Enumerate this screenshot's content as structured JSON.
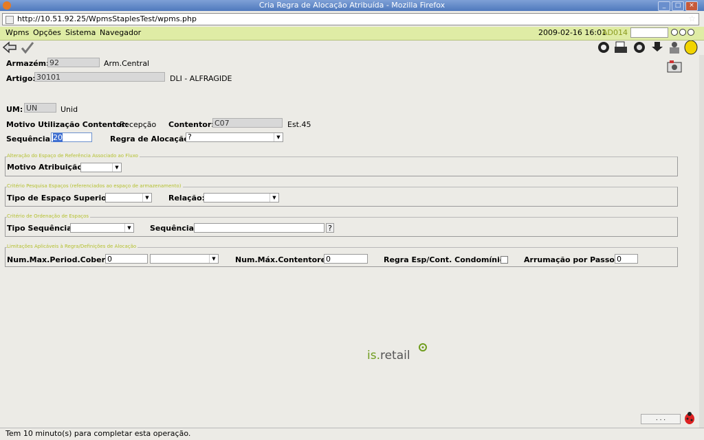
{
  "window": {
    "title": "Cria Regra de Alocação Atribuída - Mozilla Firefox",
    "buttons": [
      "_",
      "□",
      "×"
    ]
  },
  "url": "http://10.51.92.25/WpmsStaplesTest/wpms.php",
  "menu": {
    "items": [
      "Wpms",
      "Opções",
      "Sistema",
      "Navegador"
    ],
    "datetime": "2009-02-16 16:01",
    "user": "AD014"
  },
  "form": {
    "armazem_label": "Armazém:",
    "armazem_value": "92",
    "armazem_desc": "Arm.Central",
    "artigo_label": "Artigo:",
    "artigo_value": "30101",
    "artigo_desc": "DLI - ALFRAGIDE",
    "um_label": "UM:",
    "um_value": "UN",
    "um_desc": "Unid",
    "motivo_label": "Motivo Utilização Contentor:",
    "motivo_value": "Recepção",
    "contentor_label": "Contentor:",
    "contentor_value": "C07",
    "contentor_desc": "Est.45",
    "sequencia_label": "Sequência:",
    "sequencia_value": "20",
    "regra_label": "Regra de Alocação:",
    "regra_value": "?"
  },
  "sections": {
    "s1": {
      "legend": "Alteração do Espaço de Referência Associado ao Fluxo",
      "motivo_label": "Motivo Atribuição:",
      "motivo_value": ""
    },
    "s2": {
      "legend": "Critério Pesquisa Espaços (referenciados ao espaço de armazenamento)",
      "tipo_label": "Tipo de Espaço Superior:",
      "tipo_value": "",
      "relacao_label": "Relação:",
      "relacao_value": ""
    },
    "s3": {
      "legend": "Critério de Ordenação de Espaços",
      "tipo_label": "Tipo Sequência:",
      "tipo_value": "",
      "seq_label": "Sequência:",
      "seq_value": "",
      "help": "?"
    },
    "s4": {
      "legend": "Limitações Aplicáveis à Regra/Definições de Alocação",
      "period_label": "Num.Max.Period.Cobert.:",
      "period_value": "0",
      "period_unit": "",
      "cont_label": "Num.Máx.Contentores:",
      "cont_value": "0",
      "regra_label": "Regra Esp/Cont. Condomínio:",
      "regra_checked": false,
      "arrum_label": "Arrumação por Passos:",
      "arrum_value": "0"
    }
  },
  "logo": {
    "prefix": "is.",
    "suffix": "retail"
  },
  "footer": {
    "dots": ". . .",
    "status": "Tem 10 minuto(s) para completar esta operação."
  }
}
